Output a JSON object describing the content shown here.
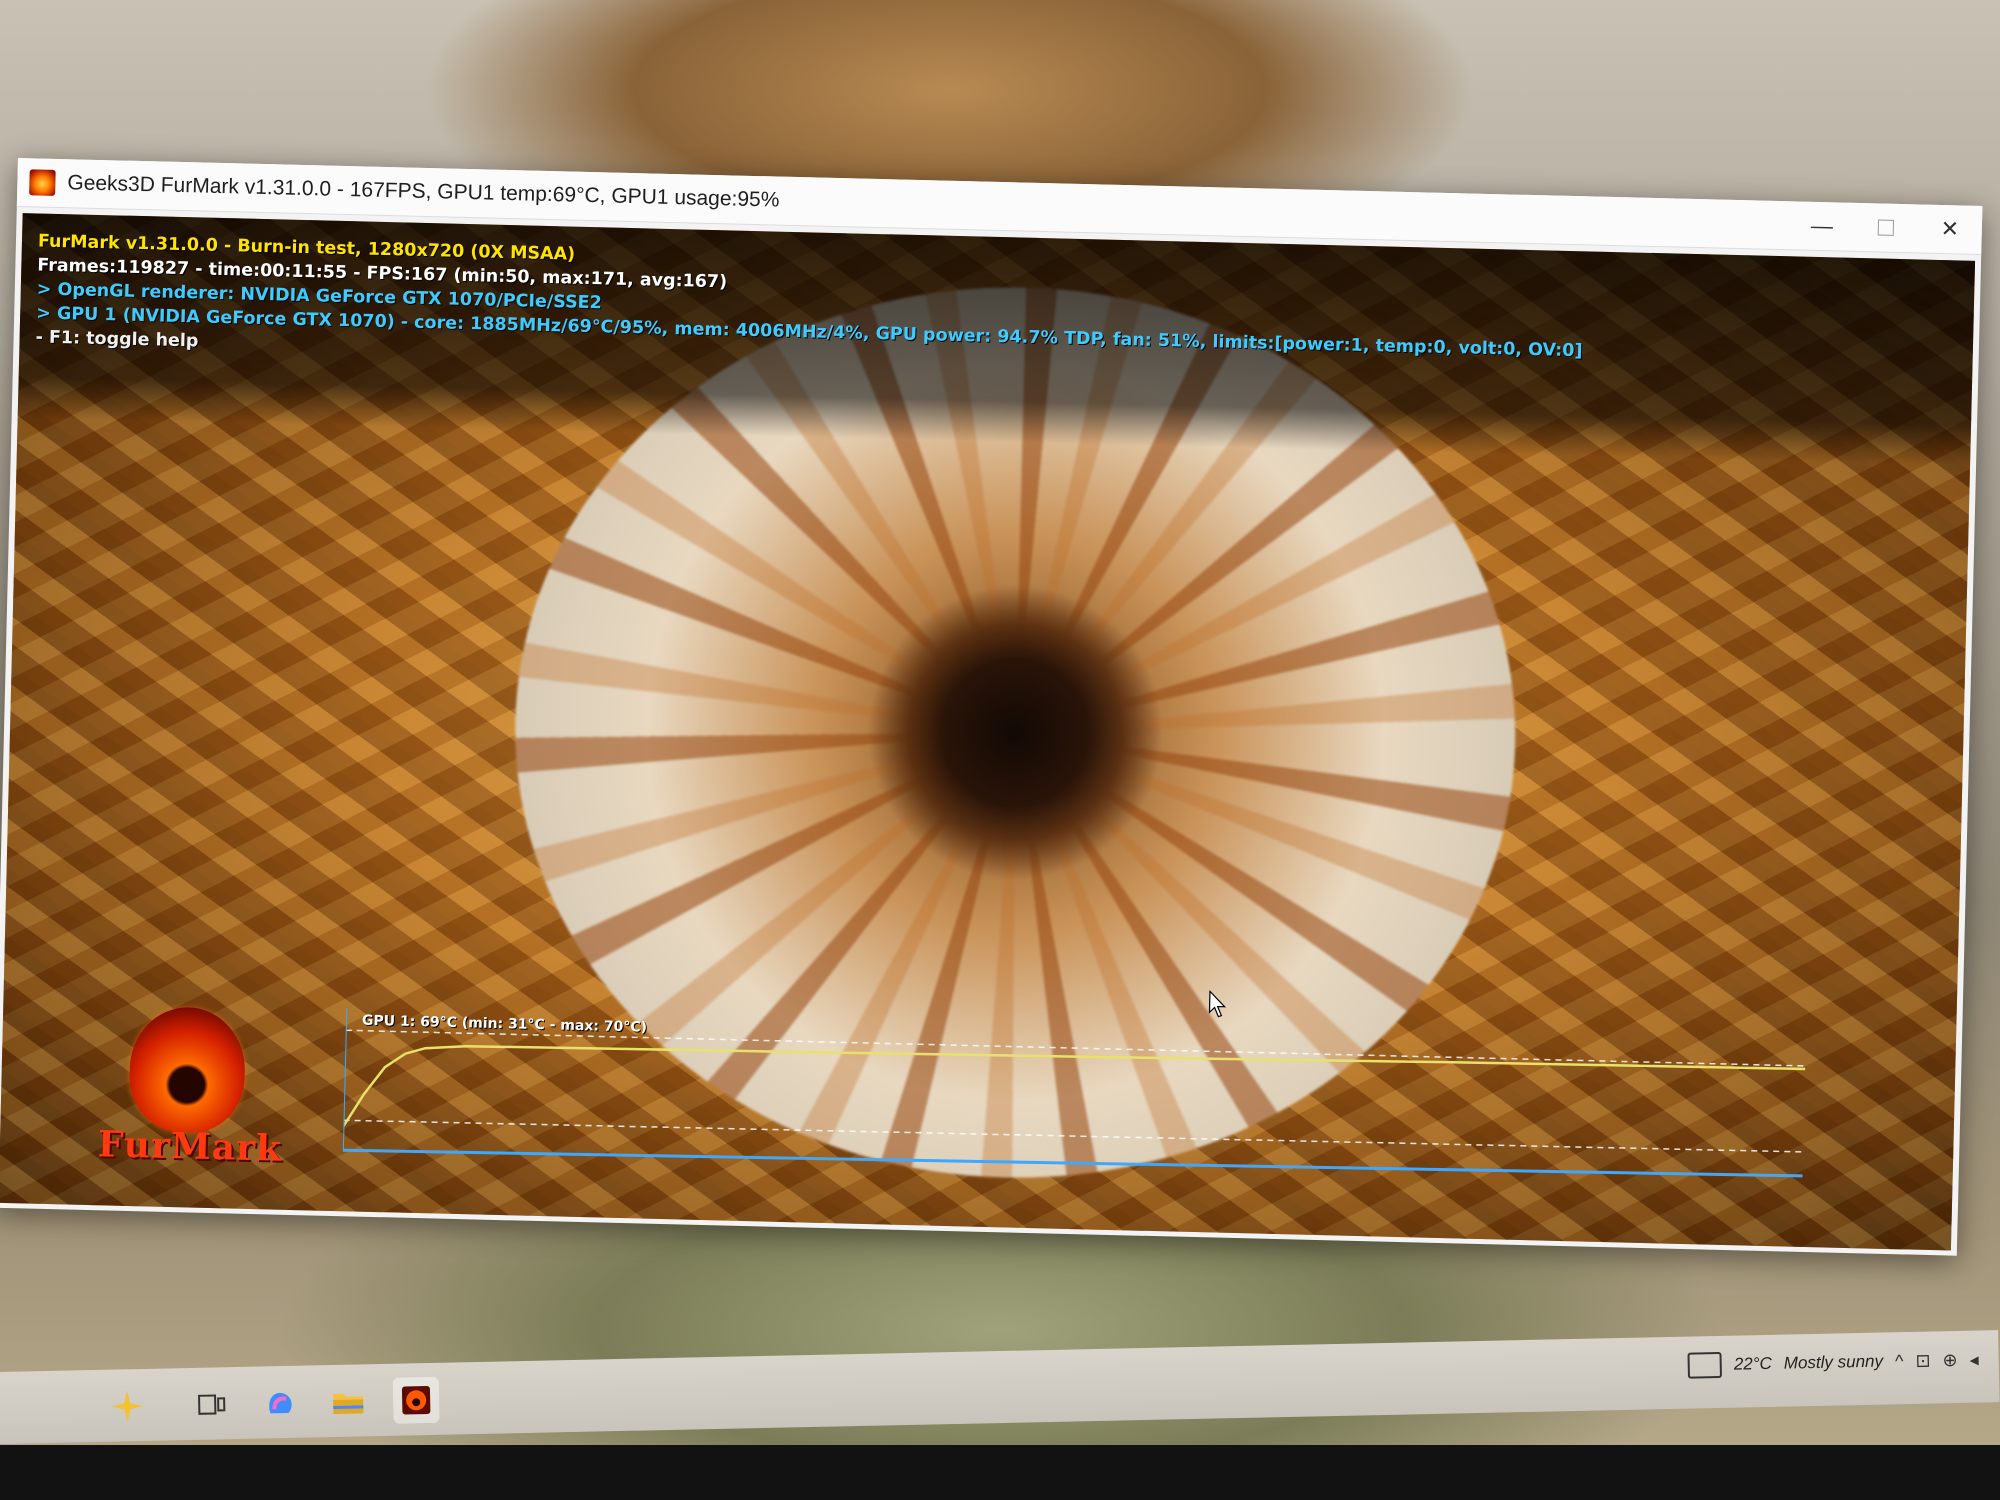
{
  "window": {
    "title": "Geeks3D FurMark v1.31.0.0 - 167FPS, GPU1 temp:69°C, GPU1 usage:95%",
    "controls": {
      "minimize": "—",
      "maximize": "",
      "close": "✕"
    }
  },
  "hud": {
    "line1": "FurMark v1.31.0.0 - Burn-in test, 1280x720 (0X MSAA)",
    "line2": "Frames:119827 - time:00:11:55 - FPS:167 (min:50, max:171, avg:167)",
    "line3": "> OpenGL renderer: NVIDIA GeForce GTX 1070/PCIe/SSE2",
    "line4": "> GPU 1 (NVIDIA GeForce GTX 1070) - core: 1885MHz/69°C/95%, mem: 4006MHz/4%, GPU power: 94.7% TDP, fan: 51%, limits:[power:1, temp:0, volt:0, OV:0]",
    "line5": "- F1: toggle help"
  },
  "logo": {
    "text": "FurMark"
  },
  "graph": {
    "label": "GPU 1: 69°C (min: 31°C - max: 70°C)",
    "line_color": "#e8e26a",
    "axis_color": "#3ea8ff"
  },
  "taskbar": {
    "items": [
      "start-icon",
      "task-view-icon",
      "copilot-icon",
      "file-explorer-icon",
      "furmark-icon"
    ],
    "weather": {
      "temp": "22°C",
      "condition": "Mostly sunny"
    }
  },
  "colors": {
    "hud_yellow": "#ffe400",
    "hud_cyan": "#3ecbff",
    "hud_white": "#ffffff"
  }
}
